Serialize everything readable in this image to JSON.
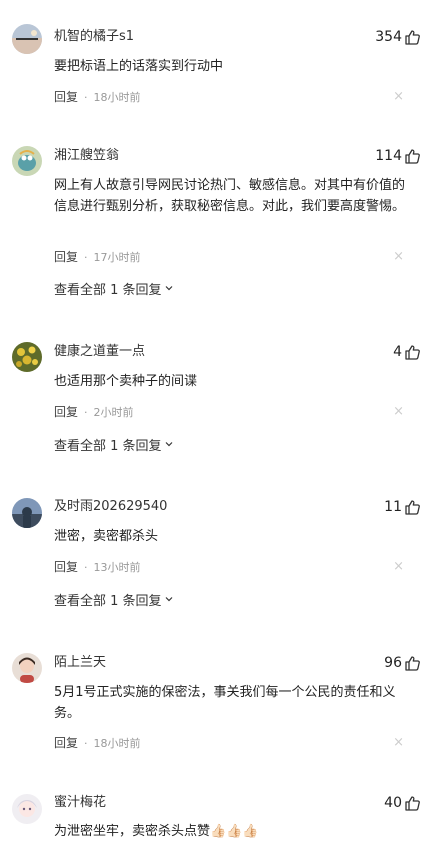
{
  "comments": [
    {
      "author": "机智的橘子s1",
      "likes": "354",
      "text": "要把标语上的话落实到行动中",
      "reply_label": "回复",
      "time": "18小时前",
      "close": "×"
    },
    {
      "author": "湘江艘笠翁",
      "likes": "114",
      "text": "网上有人故意引导网民讨论热门、敏感信息。对其中有价值的信息进行甄别分析，获取秘密信息。对此，我们要高度警惕。",
      "reply_label": "回复",
      "time": "17小时前",
      "close": "×",
      "view_all": "查看全部 1 条回复"
    },
    {
      "author": "健康之道董一点",
      "likes": "4",
      "text": "也适用那个卖种子的间谍",
      "reply_label": "回复",
      "time": "2小时前",
      "close": "×",
      "view_all": "查看全部 1 条回复"
    },
    {
      "author": "及时雨202629540",
      "likes": "11",
      "text": "泄密，卖密都杀头",
      "reply_label": "回复",
      "time": "13小时前",
      "close": "×",
      "view_all": "查看全部 1 条回复"
    },
    {
      "author": "陌上兰天",
      "likes": "96",
      "text": "5月1号正式实施的保密法，事关我们每一个公民的责任和义务。",
      "reply_label": "回复",
      "time": "18小时前",
      "close": "×"
    },
    {
      "author": "蜜汁梅花",
      "likes": "40",
      "text": "为泄密坐牢，卖密杀头点赞👍🏻👍🏻👍🏻"
    }
  ],
  "colors": {
    "text": "#222222",
    "meta": "#999999",
    "close": "#cccccc"
  },
  "icons": {
    "like": "thumbs-up-icon",
    "chevron": "chevron-down-icon",
    "close": "close-icon"
  }
}
